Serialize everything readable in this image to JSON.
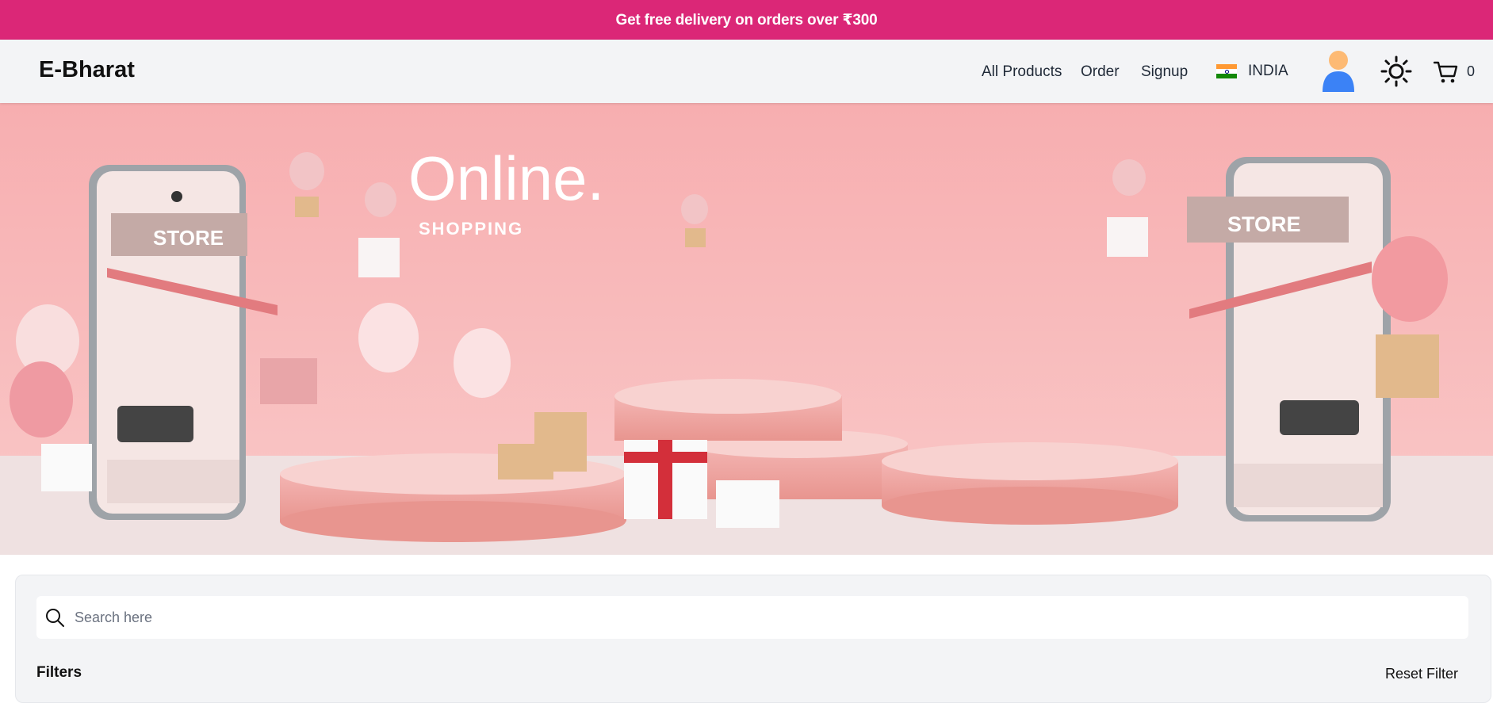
{
  "promo": {
    "text": "Get free delivery on orders over ₹300",
    "bg_color": "#db2777"
  },
  "nav": {
    "brand": "E-Bharat",
    "links": [
      "All Products",
      "Order",
      "Signup"
    ],
    "country": "INDIA",
    "country_icon": "india-flag-icon",
    "user_icon": "user-avatar-icon",
    "theme_icon": "sun-icon",
    "cart_icon": "cart-icon",
    "cart_count": "0"
  },
  "hero": {
    "headline": "Online.",
    "subline": "SHOPPING",
    "store_sign_left": "STORE",
    "store_sign_right": "STORE",
    "bg_color": "#f7b3b5"
  },
  "search": {
    "placeholder": "Search here",
    "value": "",
    "icon": "search-icon"
  },
  "filters": {
    "title": "Filters",
    "reset_label": "Reset Filter"
  }
}
